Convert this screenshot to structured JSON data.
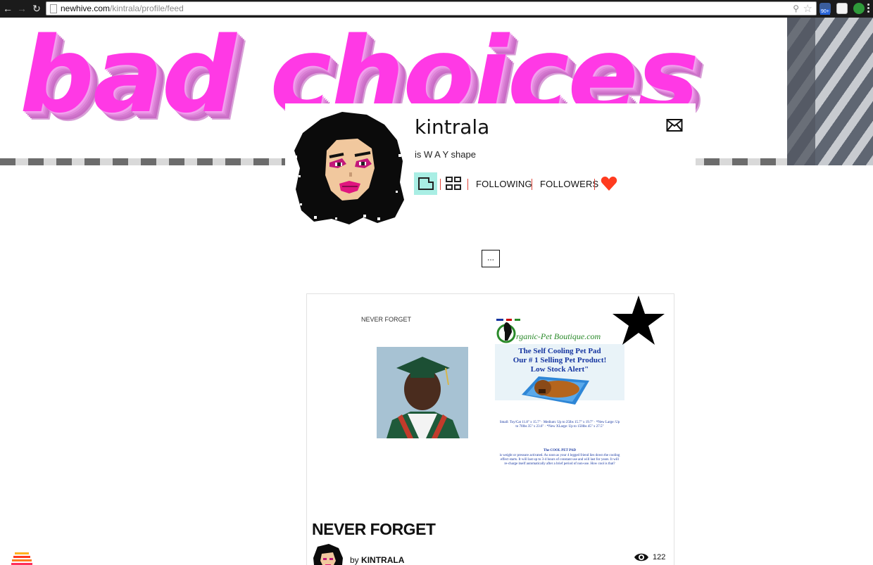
{
  "browser": {
    "url_host": "newhive.com",
    "url_path": "/kintrala/profile/feed",
    "extension_badge": "90+"
  },
  "banner": {
    "text": "bad choices"
  },
  "profile": {
    "username": "kintrala",
    "tagline": "is W A Y shape",
    "nav": {
      "following": "FOLLOWING",
      "followers": "FOLLOWERS"
    },
    "more_label": "..."
  },
  "card": {
    "inner_label": "NEVER FORGET",
    "ad": {
      "brand": "rganic-Pet Boutique.com",
      "headline": "The Self Cooling Pet Pad",
      "subline": "Our # 1 Selling Pet Product!",
      "alert": "Low Stock Alert\"",
      "sizes": "Small: Toy/Cat 11.8\" x 15.7\" · Medium: Up to 25lbs 15.7\" x 19.7\" · *New Large: Up to 70lbs 35\" x 23.6\" · *New XLarge: Up to 150lbs 45\" x 27.5\"",
      "blurb_title": "The COOL PET PAD",
      "blurb": "is weight or pressure activated. As soon as your 4 legged friend lies down the cooling effect starts. It will last up to 3-4 hours of constant use and will last for years. It will re-charge itself automatically after a brief period of non-use. How cool is that?"
    },
    "title": "NEVER FORGET",
    "by_prefix": "by",
    "author": "KINTRALA",
    "views": "122"
  }
}
